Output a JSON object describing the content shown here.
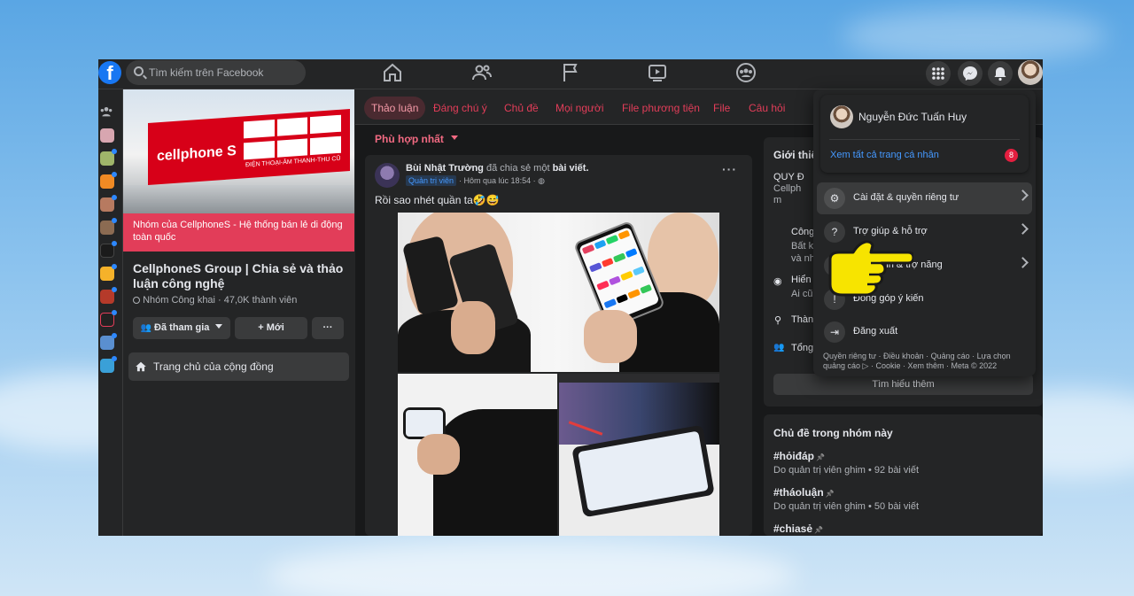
{
  "topbar": {
    "logo": "f",
    "search_placeholder": "Tìm kiếm trên Facebook",
    "nav_icons": [
      "home-icon",
      "friends-icon",
      "pages-icon",
      "watch-icon",
      "groups-icon"
    ],
    "right_icons": [
      "menu-grid-icon",
      "messenger-icon",
      "notifications-icon"
    ],
    "brand_color": "#1877f2"
  },
  "group": {
    "cover_logo": "cellphone S",
    "cover_sign": "ĐIỆN THOẠI-ÂM THANH-THU CŨ",
    "promo_text": "Nhóm của CellphoneS - Hệ thống bán lẻ di động toàn quốc",
    "title": "CellphoneS Group | Chia sẻ và thảo luận công nghệ",
    "meta": "Nhóm Công khai · 47,0K thành viên",
    "joined_label": "Đã tham gia",
    "invite_label": "+ Mới",
    "more_label": "···",
    "community_label": "Trang chủ của cộng đồng"
  },
  "tabs": [
    "Thảo luận",
    "Đáng chú ý",
    "Chủ đề",
    "Mọi người",
    "File phương tiện",
    "File",
    "Câu hỏi"
  ],
  "sort_label": "Phù hợp nhất",
  "post": {
    "author": "Bùi Nhật Trường",
    "action": " đã chia sẻ một ",
    "object": "bài viết.",
    "role": "Quản trị viên",
    "time": "· Hôm qua lúc 18:54 · ",
    "text": "Rồi sao nhét quần ta🤣😅",
    "more": "···"
  },
  "intro": {
    "heading": "Giới thiệ",
    "rows": [
      {
        "title": "QUY Đ",
        "sub": "Cellph"
      },
      {
        "title": "",
        "sub": "m"
      },
      {
        "title": "Công",
        "sub": "Bất k"
      },
      {
        "title": "",
        "sub": "và nh"
      },
      {
        "title": "Hiển",
        "sub": "Ai cũ"
      },
      {
        "title": "Thàn",
        "sub": ""
      },
      {
        "title": "Tổng",
        "sub": ""
      }
    ],
    "learn_more": "Tìm hiểu thêm"
  },
  "topics": {
    "heading": "Chủ đề trong nhóm này",
    "items": [
      {
        "tag": "#hỏiđáp",
        "desc": "Do quản trị viên ghim • 92 bài viết"
      },
      {
        "tag": "#tháoluận",
        "desc": "Do quản trị viên ghim • 50 bài viết"
      },
      {
        "tag": "#chiasẻ",
        "desc": ""
      }
    ]
  },
  "menu": {
    "profile_name": "Nguyễn Đức Tuấn Huy",
    "see_all": "Xem tất cả trang cá nhân",
    "badge": "8",
    "items": [
      {
        "label": "Cài đặt & quyền riêng tư",
        "icon": "gear-icon",
        "chevron": true
      },
      {
        "label": "Trợ giúp & hỗ trợ",
        "icon": "help-icon",
        "chevron": true
      },
      {
        "label": "Màn hình & trợ năng",
        "icon": "moon-icon",
        "chevron": true
      },
      {
        "label": "Đóng góp ý kiến",
        "icon": "feedback-icon",
        "chevron": false
      },
      {
        "label": "Đăng xuất",
        "icon": "logout-icon",
        "chevron": false
      }
    ],
    "footer": "Quyền riêng tư · Điều khoản · Quảng cáo · Lựa chọn quảng cáo ▷ · Cookie · Xem thêm · Meta © 2022"
  }
}
